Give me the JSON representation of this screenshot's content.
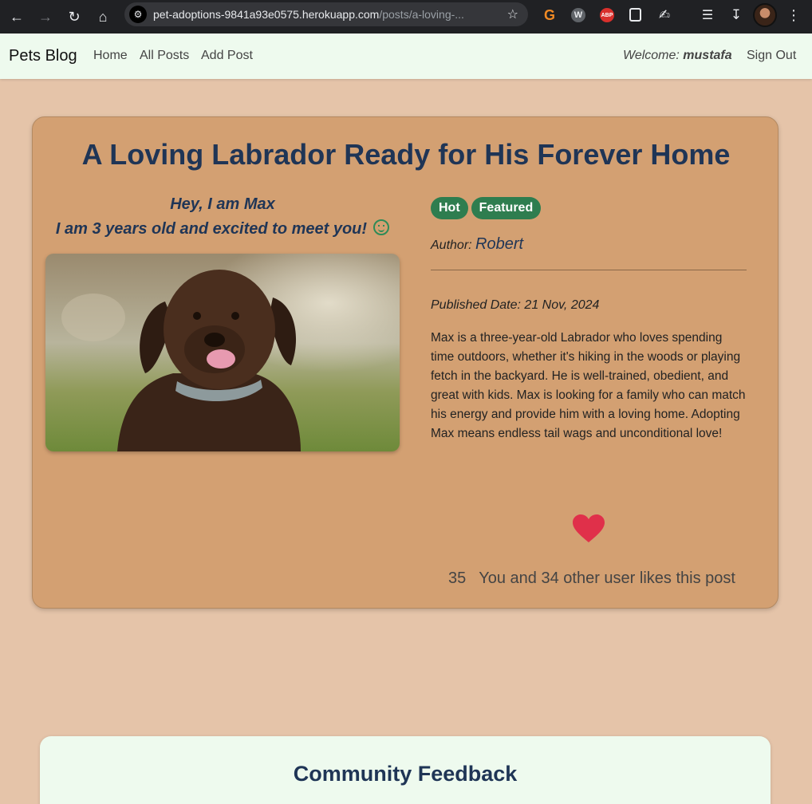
{
  "browser": {
    "url_host": "pet-adoptions-9841a93e0575.herokuapp.com",
    "url_path": "/posts/a-loving-..."
  },
  "navbar": {
    "brand": "Pets Blog",
    "links": [
      "Home",
      "All Posts",
      "Add Post"
    ],
    "welcome_label": "Welcome:",
    "username": "mustafa",
    "signout": "Sign Out"
  },
  "post": {
    "title": "A Loving Labrador Ready for His Forever Home",
    "intro_line1": "Hey, I am Max",
    "intro_line2": "I am 3 years old and excited to meet you!",
    "badges": [
      "Hot",
      "Featured"
    ],
    "author_label": "Author:",
    "author_name": "Robert",
    "published_label": "Published Date:",
    "published_date": "21 Nov, 2024",
    "body": "Max is a three-year-old Labrador who loves spending time outdoors, whether it's hiking in the woods or playing fetch in the backyard. He is well-trained, obedient, and great with kids. Max is looking for a family who can match his energy and provide him with a loving home. Adopting Max means endless tail wags and unconditional love!",
    "like_count": "35",
    "like_text": "You and 34 other user likes this post"
  },
  "feedback": {
    "title": "Community Feedback"
  },
  "colors": {
    "page_bg": "#e5c4a9",
    "card_bg": "#d3a072",
    "navbar_bg": "#eefaee",
    "title_color": "#1f3556",
    "badge_bg": "#2e7d4f",
    "heart": "#e0304a"
  }
}
